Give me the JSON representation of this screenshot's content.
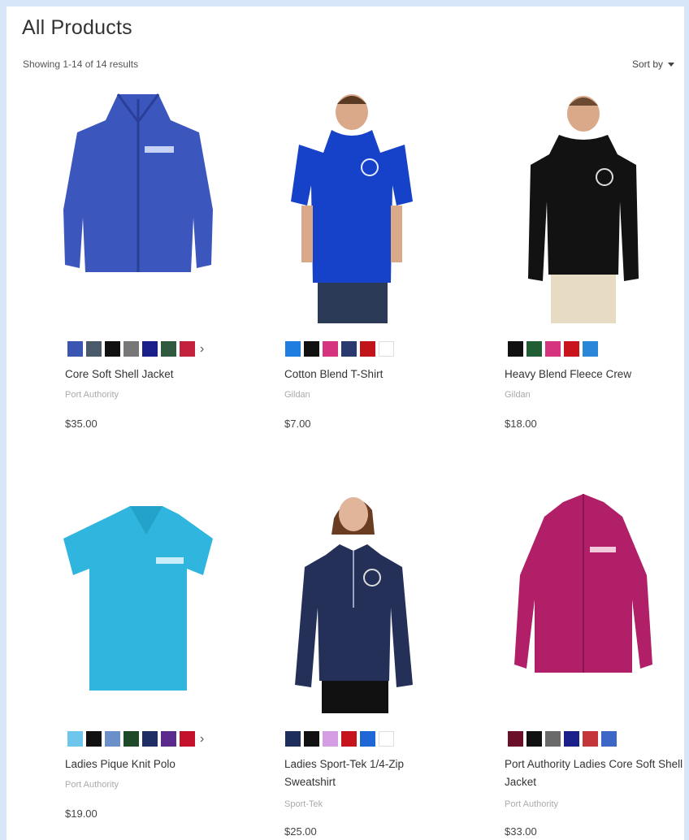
{
  "page": {
    "title": "All Products",
    "results_text": "Showing 1-14 of 14 results",
    "sort_label": "Sort by"
  },
  "products": [
    {
      "name": "Core Soft Shell Jacket",
      "brand": "Port Authority",
      "price": "$35.00",
      "swatches": [
        "#3b55b3",
        "#4a5a6b",
        "#111111",
        "#777777",
        "#1b1f8a",
        "#2f5a3f",
        "#c4223c"
      ],
      "more": true
    },
    {
      "name": "Cotton Blend T-Shirt",
      "brand": "Gildan",
      "price": "$7.00",
      "swatches": [
        "#1f7de0",
        "#111111",
        "#d6347f",
        "#2a3a6e",
        "#c0141a",
        "#ffffff"
      ],
      "more": false
    },
    {
      "name": "Heavy Blend Fleece Crew",
      "brand": "Gildan",
      "price": "$18.00",
      "swatches": [
        "#111111",
        "#215e34",
        "#d6347f",
        "#c8141c",
        "#2a86d8"
      ],
      "more": false
    },
    {
      "name": "Ladies Pique Knit Polo",
      "brand": "Port Authority",
      "price": "$19.00",
      "swatches": [
        "#6fc6ec",
        "#111111",
        "#6a8fc9",
        "#1f4a2a",
        "#1f2f66",
        "#5a2b8c",
        "#c4112c"
      ],
      "more": true
    },
    {
      "name": "Ladies Sport-Tek 1/4-Zip Sweatshirt",
      "brand": "Sport-Tek",
      "price": "$25.00",
      "swatches": [
        "#1d2d5c",
        "#111111",
        "#d59de3",
        "#c5141e",
        "#1f66d6",
        "#ffffff"
      ],
      "more": false
    },
    {
      "name": "Port Authority Ladies Core Soft Shell Jacket",
      "brand": "Port Authority",
      "price": "$33.00",
      "swatches": [
        "#6a0f27",
        "#111111",
        "#6a6a6a",
        "#1b1f8a",
        "#c4363a",
        "#3d67c7"
      ],
      "more": false
    }
  ]
}
